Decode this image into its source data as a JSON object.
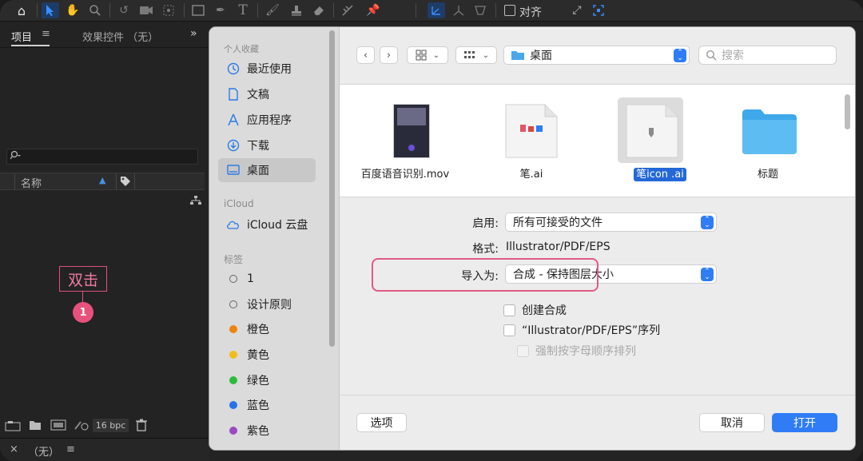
{
  "toolbar": {
    "icons": [
      "home-icon",
      "select-arrow-icon",
      "hand-icon",
      "zoom-icon",
      "rotate-icon",
      "camera-icon",
      "pan-behind-icon",
      "rectangle-icon",
      "pen-icon",
      "type-icon",
      "brush-icon",
      "clone-stamp-icon",
      "eraser-icon",
      "roto-brush-icon",
      "puppet-pin-icon",
      "axis-local-icon",
      "axis-world-icon",
      "axis-view-icon"
    ],
    "snap_label": "对齐"
  },
  "left_panel": {
    "tab_project": "项目",
    "tab_effects": "效果控件 （无）",
    "column_name": "名称",
    "bpc": "16 bpc"
  },
  "annotation": {
    "label": "双击",
    "badge": "1"
  },
  "bottom_bar": {
    "close": "×",
    "label": "（无）",
    "menu": "≡"
  },
  "dialog": {
    "sidebar": {
      "favorites_title": "个人收藏",
      "favorites": [
        {
          "label": "最近使用",
          "icon": "clock-icon"
        },
        {
          "label": "文稿",
          "icon": "document-icon"
        },
        {
          "label": "应用程序",
          "icon": "applications-icon"
        },
        {
          "label": "下载",
          "icon": "download-icon"
        },
        {
          "label": "桌面",
          "icon": "desktop-icon",
          "selected": true
        }
      ],
      "icloud_title": "iCloud",
      "icloud_item": "iCloud 云盘",
      "tags_title": "标签",
      "tags": [
        {
          "label": "1",
          "color": "hollow"
        },
        {
          "label": "设计原则",
          "color": "hollow"
        },
        {
          "label": "橙色",
          "color": "#f0820e"
        },
        {
          "label": "黄色",
          "color": "#f2bd1b"
        },
        {
          "label": "绿色",
          "color": "#2dbb3a"
        },
        {
          "label": "蓝色",
          "color": "#2673e8"
        },
        {
          "label": "紫色",
          "color": "#9a49c2"
        }
      ]
    },
    "location": "桌面",
    "search_placeholder": "搜索",
    "files": [
      {
        "name": "百度语音识别.mov",
        "kind": "video"
      },
      {
        "name": "笔.ai",
        "kind": "ai"
      },
      {
        "name": "笔icon .ai",
        "kind": "ai",
        "selected": true
      },
      {
        "name": "标题",
        "kind": "folder"
      }
    ],
    "options": {
      "enable_label": "启用:",
      "enable_value": "所有可接受的文件",
      "format_label": "格式:",
      "format_value": "Illustrator/PDF/EPS",
      "import_as_label": "导入为:",
      "import_as_value": "合成 - 保持图层大小",
      "create_comp": "创建合成",
      "sequence": "“Illustrator/PDF/EPS”序列",
      "force_alpha": "强制按字母顺序排列"
    },
    "buttons": {
      "options": "选项",
      "cancel": "取消",
      "open": "打开"
    }
  },
  "colors": {
    "accent": "#2f7cf6",
    "annotation": "#e25a85",
    "ae_toolbar": "#2b2b2b"
  }
}
